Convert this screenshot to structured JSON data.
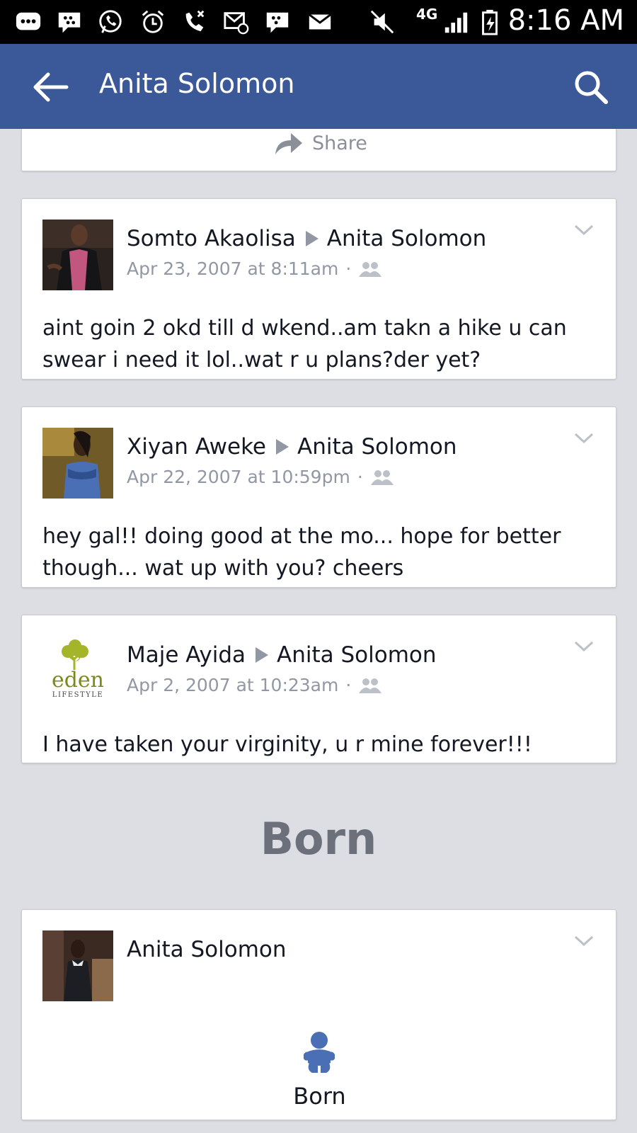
{
  "status_bar": {
    "network": "4G",
    "time": "8:16 AM"
  },
  "app_bar": {
    "title": "Anita Solomon"
  },
  "share_card": {
    "share_label": "Share"
  },
  "posts": [
    {
      "author": "Somto Akaolisa",
      "target": "Anita Solomon",
      "date": "Apr 23, 2007 at 8:11am",
      "dot": "·",
      "text": "aint goin 2 okd till d wkend..am takn a hike u can swear i need it lol..wat r u plans?der yet?"
    },
    {
      "author": "Xiyan Aweke",
      "target": "Anita Solomon",
      "date": "Apr 22, 2007 at 10:59pm",
      "dot": "·",
      "text": "hey gal!! doing good at the mo... hope for better though... wat up with you? cheers"
    },
    {
      "author": "Maje Ayida",
      "target": "Anita Solomon",
      "date": "Apr 2, 2007 at 10:23am",
      "dot": "·",
      "text": "I have taken your virginity, u r mine forever!!!"
    }
  ],
  "avatar_logo": {
    "brand": "eden",
    "tagline": "LIFESTYLE"
  },
  "section_heading": "Born",
  "life_event": {
    "author": "Anita Solomon",
    "event_label": "Born"
  },
  "colors": {
    "app_bar": "#3b5998",
    "background": "#dcdee3",
    "meta_text": "#9197a3"
  }
}
